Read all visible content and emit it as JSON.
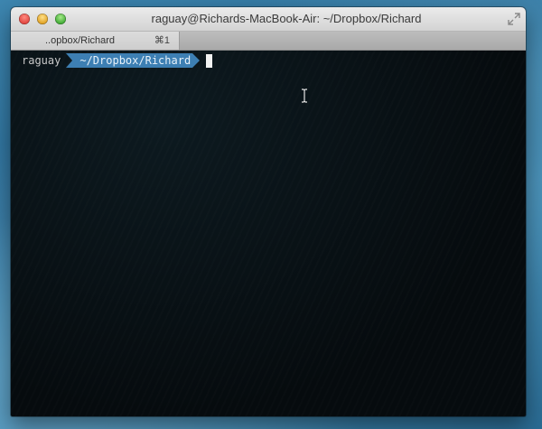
{
  "window": {
    "title": "raguay@Richards-MacBook-Air: ~/Dropbox/Richard"
  },
  "tabs": [
    {
      "label": "..opbox/Richard",
      "shortcut": "⌘1"
    }
  ],
  "prompt": {
    "user": "raguay",
    "path": "~/Dropbox/Richard"
  },
  "colors": {
    "path_segment": "#3d7fb3",
    "terminal_bg": "#070c10"
  },
  "icons": {
    "close": "close-icon",
    "minimize": "minimize-icon",
    "zoom": "zoom-icon",
    "fullscreen": "fullscreen-icon",
    "text_cursor": "ibeam-cursor-icon"
  }
}
